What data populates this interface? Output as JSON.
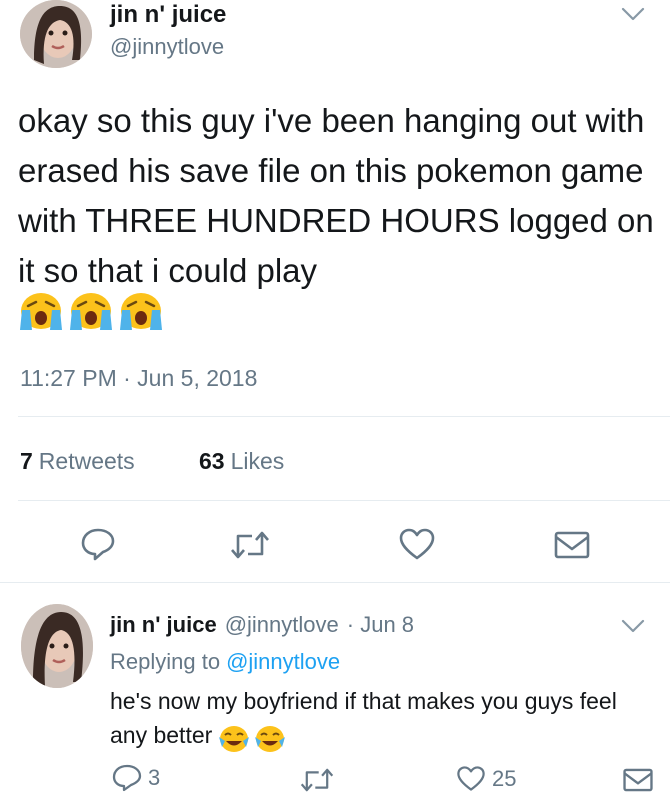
{
  "tweet": {
    "author": {
      "name": "jin n' juice",
      "handle": "@jinnytlove"
    },
    "text": "okay so this guy i've been hanging out with erased his save file on this pokemon game with THREE HUNDRED HOURS logged on it so that i could play",
    "emojis": [
      "crying-face",
      "crying-face",
      "crying-face"
    ],
    "timestamp": "11:27 PM · Jun 5, 2018",
    "retweets": {
      "count": "7",
      "label": "Retweets"
    },
    "likes": {
      "count": "63",
      "label": "Likes"
    }
  },
  "reply": {
    "author": {
      "name": "jin n' juice",
      "handle": "@jinnytlove"
    },
    "date": "· Jun 8",
    "replying_label": "Replying to",
    "replying_handle": "@jinnytlove",
    "text": "he's now my boyfriend if that makes you guys feel any better",
    "emojis": [
      "tears-of-joy-face",
      "tears-of-joy-face"
    ],
    "reply_count": "3",
    "like_count": "25"
  },
  "colors": {
    "text": "#14171a",
    "secondary": "#657786",
    "link": "#1da1f2",
    "divider": "#e6ecf0"
  }
}
